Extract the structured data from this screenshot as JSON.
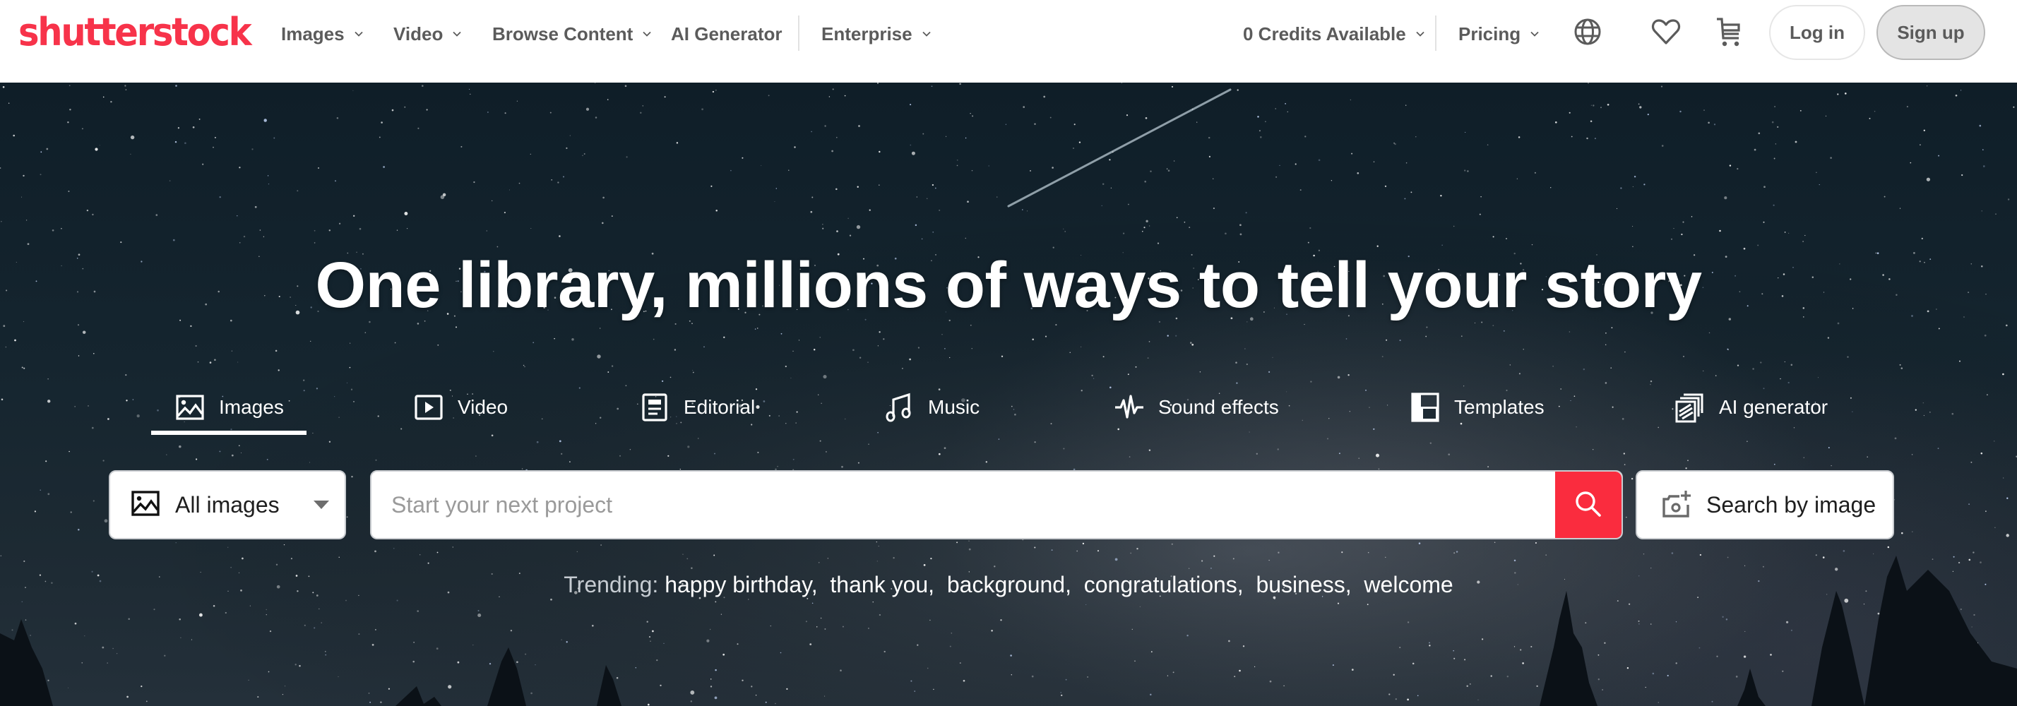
{
  "brand": {
    "logo_text": "shutterstock",
    "accent_color": "#f7334a",
    "search_button_color": "#fa2c3e"
  },
  "header": {
    "nav": [
      {
        "label": "Images",
        "has_dropdown": true
      },
      {
        "label": "Video",
        "has_dropdown": true
      },
      {
        "label": "Browse Content",
        "has_dropdown": true
      },
      {
        "label": "AI Generator",
        "has_dropdown": false
      },
      {
        "label": "Enterprise",
        "has_dropdown": true
      }
    ],
    "credits": {
      "label": "0 Credits Available",
      "has_dropdown": true
    },
    "pricing": {
      "label": "Pricing",
      "has_dropdown": true
    },
    "icons": [
      "globe-icon",
      "heart-icon",
      "cart-icon"
    ],
    "login_label": "Log in",
    "signup_label": "Sign up"
  },
  "hero": {
    "headline": "One library, millions of ways to tell your story",
    "tabs": [
      {
        "label": "Images",
        "icon": "image-icon",
        "active": true
      },
      {
        "label": "Video",
        "icon": "video-play-icon",
        "active": false
      },
      {
        "label": "Editorial",
        "icon": "editorial-icon",
        "active": false
      },
      {
        "label": "Music",
        "icon": "music-note-icon",
        "active": false
      },
      {
        "label": "Sound effects",
        "icon": "waveform-icon",
        "active": false
      },
      {
        "label": "Templates",
        "icon": "templates-icon",
        "active": false
      },
      {
        "label": "AI generator",
        "icon": "ai-generator-icon",
        "active": false
      }
    ],
    "search": {
      "type_selector": "All images",
      "placeholder": "Start your next project",
      "value": "",
      "search_by_image_label": "Search by image"
    },
    "trending": {
      "label": "Trending:",
      "terms": [
        "happy birthday,",
        "thank you,",
        "background,",
        "congratulations,",
        "business,",
        "welcome"
      ]
    }
  }
}
